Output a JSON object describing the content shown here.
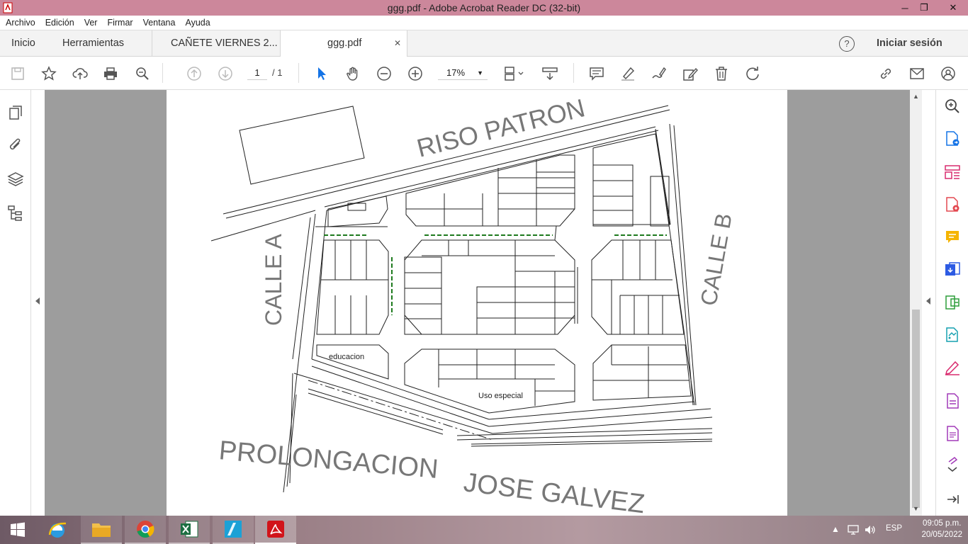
{
  "window": {
    "title": "ggg.pdf - Adobe Acrobat Reader DC (32-bit)",
    "controls": {
      "minimize": "─",
      "restore": "❐",
      "close": "✕"
    }
  },
  "menu": [
    "Archivo",
    "Edición",
    "Ver",
    "Firmar",
    "Ventana",
    "Ayuda"
  ],
  "tabs": {
    "home": "Inicio",
    "tools": "Herramientas",
    "doc1": "CAÑETE VIERNES 2...",
    "doc2": "ggg.pdf",
    "close": "✕",
    "help": "?",
    "signin": "Iniciar sesión"
  },
  "toolbar": {
    "page_current": "1",
    "page_total": "/ 1",
    "zoom": "17%"
  },
  "drawing": {
    "street_top": "RISO PATRON",
    "street_left": "CALLE A",
    "street_right": "CALLE B",
    "street_bottom_1": "PROLONGACION",
    "street_bottom_2": "JOSE GALVEZ",
    "label_educacion": "educacion",
    "label_uso": "Uso especial"
  },
  "taskbar": {
    "lang": "ESP",
    "time": "09:05 p.m.",
    "date": "20/05/2022"
  },
  "colors": {
    "titlebar": "#cc879b",
    "accent": "#1473e6",
    "viewer_bg": "#9d9d9d"
  }
}
